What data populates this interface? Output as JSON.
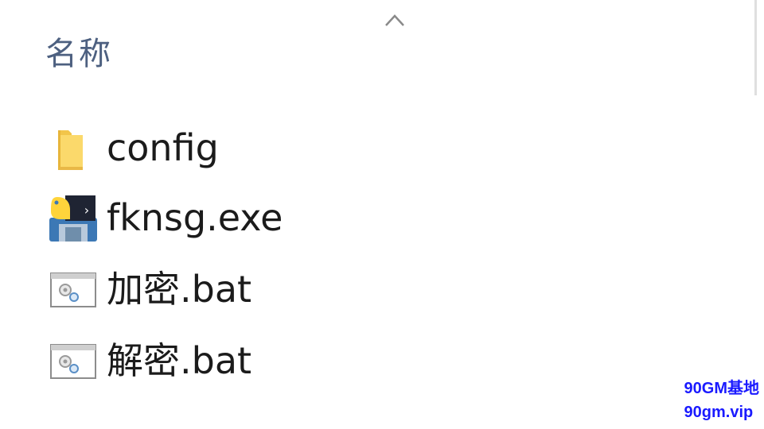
{
  "header": {
    "column_name": "名称",
    "sort_icon": "chevron-up-icon"
  },
  "files": [
    {
      "name": "config",
      "icon": "folder-icon"
    },
    {
      "name": "fknsg.exe",
      "icon": "python-exe-icon"
    },
    {
      "name": "加密.bat",
      "icon": "batch-file-icon"
    },
    {
      "name": "解密.bat",
      "icon": "batch-file-icon"
    }
  ],
  "watermark": {
    "line1": "90GM基地",
    "line2": "90gm.vip",
    "color": "#1a1aff"
  }
}
